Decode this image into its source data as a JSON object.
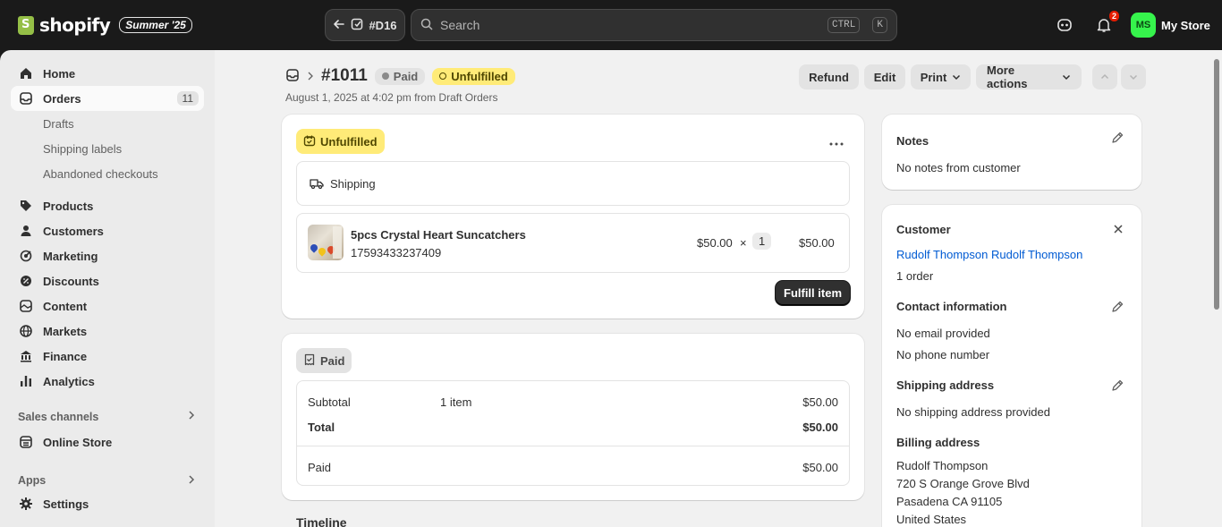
{
  "topbar": {
    "brand": "shopify",
    "edition": "Summer '25",
    "back_label": "#D16",
    "search_placeholder": "Search",
    "kbd_ctrl": "CTRL",
    "kbd_k": "K",
    "notification_count": "2",
    "avatar_initials": "MS",
    "store_name": "My Store"
  },
  "sidebar": {
    "home": "Home",
    "orders": "Orders",
    "orders_count": "11",
    "drafts": "Drafts",
    "shipping_labels": "Shipping labels",
    "abandoned_checkouts": "Abandoned checkouts",
    "products": "Products",
    "customers": "Customers",
    "marketing": "Marketing",
    "discounts": "Discounts",
    "content": "Content",
    "markets": "Markets",
    "finance": "Finance",
    "analytics": "Analytics",
    "sales_channels": "Sales channels",
    "online_store": "Online Store",
    "apps": "Apps",
    "settings": "Settings"
  },
  "header": {
    "order_number": "#1011",
    "paid_badge": "Paid",
    "unfulfilled_badge": "Unfulfilled",
    "subtitle": "August 1, 2025 at 4:02 pm from Draft Orders",
    "refund": "Refund",
    "edit": "Edit",
    "print": "Print",
    "more_actions": "More actions"
  },
  "fulfillment": {
    "status": "Unfulfilled",
    "method": "Shipping",
    "product_name": "5pcs Crystal Heart Suncatchers",
    "product_sku": "17593433237409",
    "unit_price": "$50.00",
    "times": "×",
    "quantity": "1",
    "line_total": "$50.00",
    "fulfill_button": "Fulfill item"
  },
  "payment": {
    "status": "Paid",
    "subtotal_label": "Subtotal",
    "subtotal_items": "1 item",
    "subtotal_value": "$50.00",
    "total_label": "Total",
    "total_value": "$50.00",
    "paid_label": "Paid",
    "paid_value": "$50.00"
  },
  "timeline": {
    "title": "Timeline"
  },
  "notes": {
    "title": "Notes",
    "text": "No notes from customer"
  },
  "customer": {
    "title": "Customer",
    "name": "Rudolf Thompson Rudolf Thompson",
    "orders": "1 order",
    "contact_title": "Contact information",
    "email": "No email provided",
    "phone": "No phone number",
    "shipping_title": "Shipping address",
    "shipping_text": "No shipping address provided",
    "billing_title": "Billing address",
    "billing_line1": "Rudolf Thompson",
    "billing_line2": "720 S Orange Grove Blvd",
    "billing_line3": "Pasadena CA 91105",
    "billing_line4": "United States"
  }
}
